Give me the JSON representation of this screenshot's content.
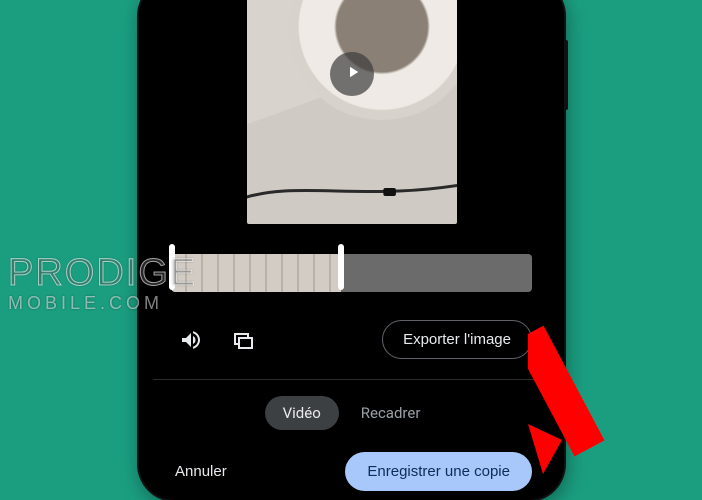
{
  "watermark": {
    "line1": "PRODIGE",
    "line2": "MOBILE.COM"
  },
  "controls": {
    "volume_icon": "volume-icon",
    "frame_icon": "frame-export-icon",
    "export_label": "Exporter l'image"
  },
  "segmented": {
    "video_label": "Vidéo",
    "crop_label": "Recadrer"
  },
  "bottom": {
    "cancel_label": "Annuler",
    "save_label": "Enregistrer une copie"
  },
  "colors": {
    "stage_bg": "#1b9e80",
    "accent_button_bg": "#a8c7fa",
    "accent_button_fg": "#0b2e59"
  }
}
